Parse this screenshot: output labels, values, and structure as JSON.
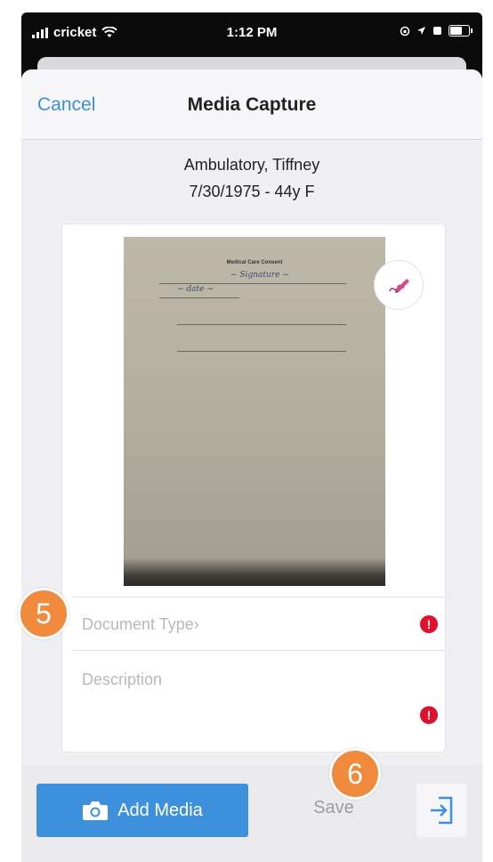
{
  "status_bar": {
    "carrier": "cricket",
    "time": "1:12 PM"
  },
  "nav": {
    "cancel_label": "Cancel",
    "title": "Media Capture"
  },
  "patient": {
    "name": "Ambulatory, Tiffney",
    "dob_age_sex": "7/30/1975 - 44y F"
  },
  "document_preview": {
    "heading": "Medical Care Consent"
  },
  "form": {
    "document_type_label": "Document Type›",
    "description_label": "Description",
    "required_marker": "!"
  },
  "footer": {
    "add_media_label": "Add Media",
    "save_label": "Save"
  },
  "callouts": {
    "step_5": "5",
    "step_6": "6"
  },
  "colors": {
    "accent_blue": "#3d91dc",
    "required_red": "#e0112b",
    "callout_orange": "#f08a3c"
  }
}
